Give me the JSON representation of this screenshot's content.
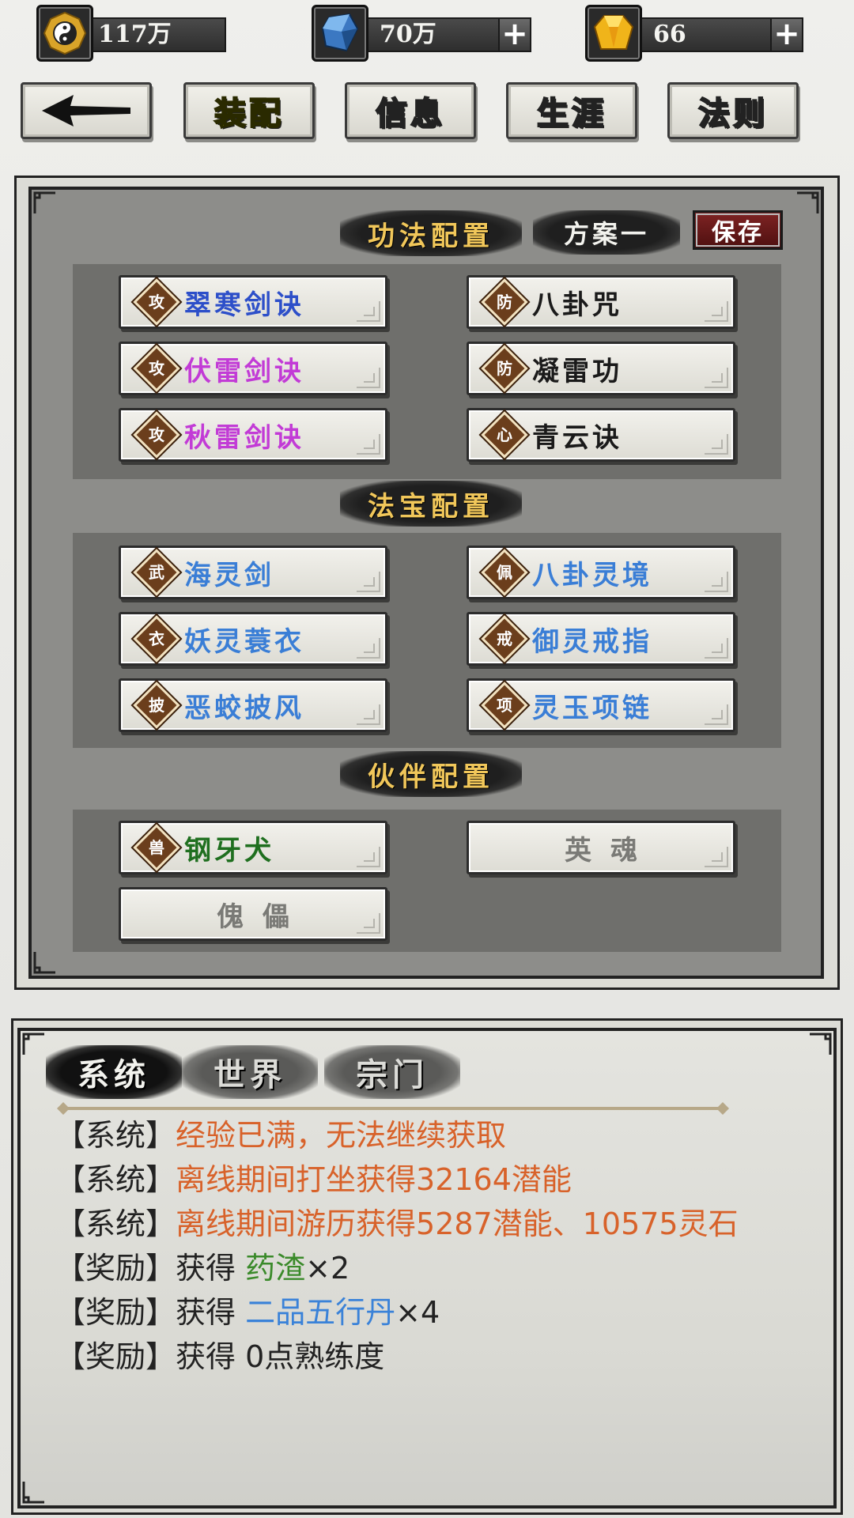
{
  "currencies": {
    "taiji": {
      "value": "117万",
      "icon": "taiji-coin-icon"
    },
    "crystal": {
      "value": "70万",
      "icon": "blue-crystal-icon",
      "plus": "+"
    },
    "gem": {
      "value": "66",
      "icon": "gold-gem-icon",
      "plus": "+"
    }
  },
  "nav": {
    "back_icon": "back-arrow-icon",
    "tabs": [
      "装配",
      "信息",
      "生涯",
      "法则"
    ],
    "active": "装配"
  },
  "skills": {
    "title": "功法配置",
    "plan": "方案一",
    "save": "保存",
    "slots": [
      {
        "tag": "攻",
        "name": "翠寒剑诀",
        "color": "#2d4fc9"
      },
      {
        "tag": "防",
        "name": "八卦咒",
        "color": "#1a1a1a"
      },
      {
        "tag": "攻",
        "name": "伏雷剑诀",
        "color": "#c23bd6"
      },
      {
        "tag": "防",
        "name": "凝雷功",
        "color": "#1a1a1a"
      },
      {
        "tag": "攻",
        "name": "秋雷剑诀",
        "color": "#c23bd6"
      },
      {
        "tag": "心",
        "name": "青云诀",
        "color": "#1a1a1a"
      }
    ]
  },
  "treasures": {
    "title": "法宝配置",
    "slots": [
      {
        "tag": "武",
        "name": "海灵剑",
        "color": "#3a7ed6"
      },
      {
        "tag": "佩",
        "name": "八卦灵境",
        "color": "#3a7ed6"
      },
      {
        "tag": "衣",
        "name": "妖灵蓑衣",
        "color": "#3a7ed6"
      },
      {
        "tag": "戒",
        "name": "御灵戒指",
        "color": "#3a7ed6"
      },
      {
        "tag": "披",
        "name": "恶蛟披风",
        "color": "#3a7ed6"
      },
      {
        "tag": "项",
        "name": "灵玉项链",
        "color": "#3a7ed6"
      }
    ]
  },
  "partners": {
    "title": "伙伴配置",
    "pet": {
      "tag": "兽",
      "name": "钢牙犬",
      "color": "#1f6f1f"
    },
    "soul": "英魂",
    "puppet": "傀儡"
  },
  "chat": {
    "tabs": [
      "系统",
      "世界",
      "宗门"
    ],
    "messages": [
      {
        "prefix": "【系统】",
        "parts": [
          {
            "text": "经验已满，无法继续获取",
            "cls": "orange"
          }
        ]
      },
      {
        "prefix": "【系统】",
        "parts": [
          {
            "text": "离线期间打坐获得32164潜能",
            "cls": "orange"
          }
        ]
      },
      {
        "prefix": "【系统】",
        "parts": [
          {
            "text": "离线期间游历获得5287潜能、10575灵石",
            "cls": "orange"
          }
        ]
      },
      {
        "prefix": "【奖励】",
        "parts": [
          {
            "text": "获得 ",
            "cls": ""
          },
          {
            "text": "药渣",
            "cls": "green"
          },
          {
            "text": "×2",
            "cls": ""
          }
        ]
      },
      {
        "prefix": "【奖励】",
        "parts": [
          {
            "text": "获得 ",
            "cls": ""
          },
          {
            "text": "二品五行丹",
            "cls": "blue"
          },
          {
            "text": "×4",
            "cls": ""
          }
        ]
      },
      {
        "prefix": "【奖励】",
        "parts": [
          {
            "text": "获得 0点熟练度",
            "cls": ""
          }
        ]
      }
    ]
  }
}
